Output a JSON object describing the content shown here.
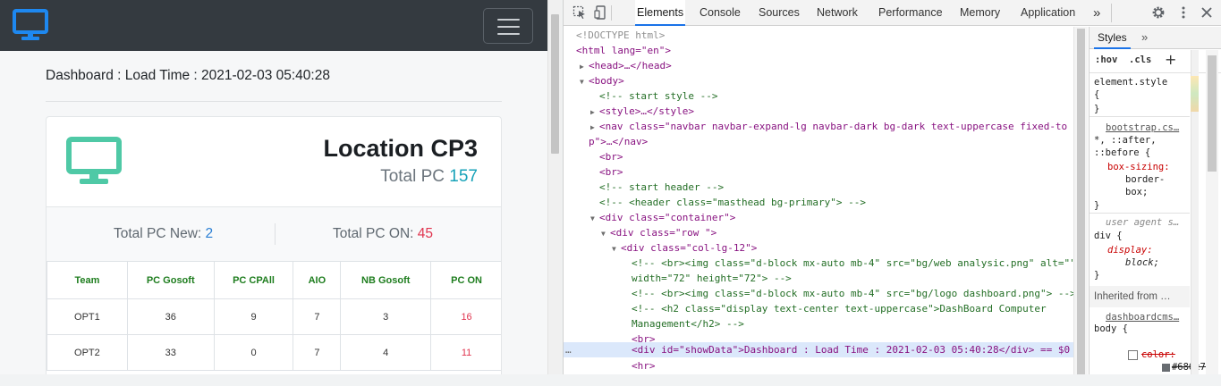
{
  "page": {
    "dashboard_text": "Dashboard : Load Time : 2021-02-03 05:40:28",
    "location_title": "Location CP3",
    "total_pc_label": "Total PC",
    "total_pc_value": "157",
    "total_pc_new_label": "Total PC New:",
    "total_pc_new_value": "2",
    "total_pc_on_label": "Total PC ON:",
    "total_pc_on_value": "45",
    "table": {
      "headers": [
        "Team",
        "PC Gosoft",
        "PC CPAll",
        "AIO",
        "NB Gosoft",
        "PC ON"
      ],
      "rows": [
        [
          "OPT1",
          "36",
          "9",
          "7",
          "3",
          "16"
        ],
        [
          "OPT2",
          "33",
          "0",
          "7",
          "4",
          "11"
        ]
      ]
    },
    "colors": {
      "navbar": "#343a40",
      "brand_icon": "#1e88f0",
      "card_icon": "#4fc9a6",
      "total_pc_value": "#17a2b8",
      "new_value": "#2a7fd4",
      "on_value": "#e0344e",
      "table_header": "#1e7d1e"
    },
    "icons": {
      "brand": "monitor-icon",
      "card": "monitor-icon",
      "menu": "hamburger-icon"
    }
  },
  "devtools": {
    "tabs": [
      "Elements",
      "Console",
      "Sources",
      "Network",
      "Performance",
      "Memory",
      "Application"
    ],
    "active_tab": "Elements",
    "more_tabs": "»",
    "toolbar_icons": [
      "inspect-icon",
      "device-toggle-icon",
      "settings-icon",
      "more-vert-icon",
      "close-icon"
    ],
    "dom_lines": [
      "<!DOCTYPE html>",
      "<html lang=\"en\">",
      "<head>…</head>",
      "<body>",
      "<!-- start style -->",
      "<style>…</style>",
      "<nav class=\"navbar navbar-expand-lg navbar-dark bg-dark text-uppercase fixed-to",
      "p\">…</nav>",
      "<br>",
      "<br>",
      "<!-- start header -->",
      "<!-- <header class=\"masthead bg-primary\"> -->",
      "<div class=\"container\">",
      "<div class=\"row \">",
      "<div class=\"col-lg-12\">",
      "<!-- <br><img class=\"d-block mx-auto mb-4\" src=\"bg/web analysic.png\" alt=\"\"",
      "width=\"72\" height=\"72\"> -->",
      "<!-- <br><img class=\"d-block mx-auto mb-4\" src=\"bg/logo dashboard.png\"> -->",
      "<!-- <h2 class=\"display text-center text-uppercase\">DashBoard Computer",
      "Management</h2> -->",
      "<br>",
      "<div id=\"showData\">Dashboard : Load Time : 2021-02-03 05:40:28</div> == $0",
      "<hr>"
    ],
    "selected_marker": "…",
    "styles": {
      "tab": "Styles",
      "more": "»",
      "hov": ":hov",
      "cls": ".cls",
      "plus": "+",
      "element_style": "element.style",
      "open_brace": "{",
      "close_brace": "}",
      "bootstrap_link": "bootstrap.cs…",
      "bootstrap_selector_1": "*, ::after,",
      "bootstrap_selector_2": "::before {",
      "box_sizing_prop": "box-sizing:",
      "box_sizing_val_1": "border-",
      "box_sizing_val_2": "box;",
      "ua_label": "user agent s…",
      "ua_selector": "div {",
      "display_prop": "display:",
      "display_val": "block;",
      "inherited_label": "Inherited from …",
      "dash_link": "dashboardcms…",
      "body_selector": "body {",
      "color_prop": "color:",
      "color_val": "#686c71;"
    }
  }
}
